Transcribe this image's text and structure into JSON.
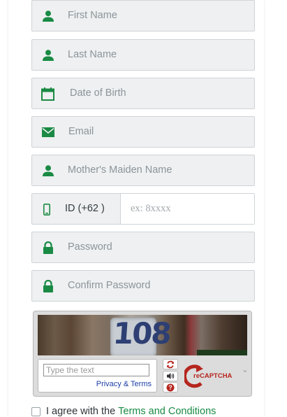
{
  "form": {
    "first_name_placeholder": "First Name",
    "last_name_placeholder": "Last Name",
    "dob_placeholder": "Date of Birth",
    "email_placeholder": "Email",
    "mother_maiden_placeholder": "Mother's Maiden Name",
    "phone_prefix": "ID (+62 )",
    "phone_placeholder": "ex: 8xxxx",
    "password_placeholder": "Password",
    "confirm_password_placeholder": "Confirm Password"
  },
  "captcha": {
    "challenge_text": "108",
    "input_placeholder": "Type the text",
    "privacy_terms": "Privacy & Terms",
    "logo_text": "reCAPTCHA",
    "help_glyph": "?"
  },
  "agreement": {
    "label": "I agree with the",
    "link_text": "Terms and Conditions"
  },
  "colors": {
    "accent_green": "#1a8a44",
    "field_bg": "#eef0f1",
    "recaptcha_red": "#b5261e"
  }
}
